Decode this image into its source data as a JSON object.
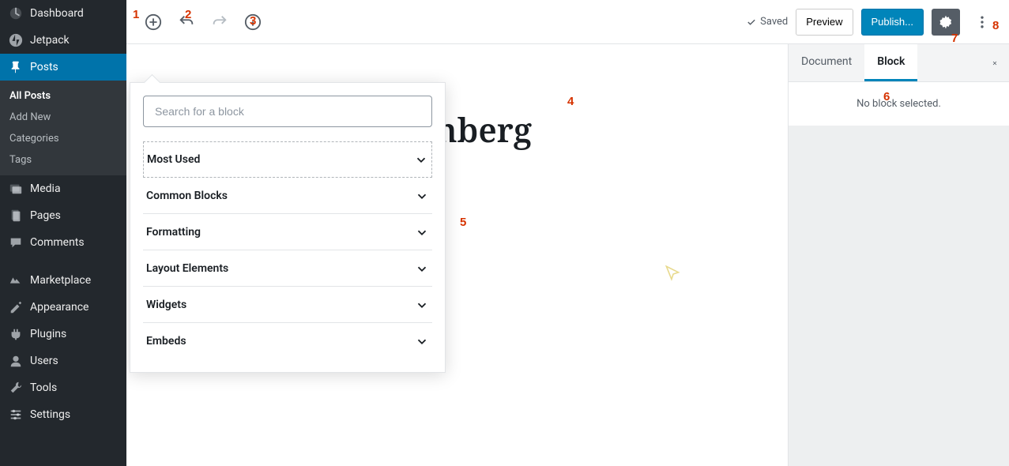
{
  "annotations": [
    "1",
    "2",
    "3",
    "4",
    "5",
    "6",
    "7",
    "8"
  ],
  "sidebar": {
    "items": [
      {
        "label": "Dashboard"
      },
      {
        "label": "Jetpack"
      },
      {
        "label": "Posts"
      },
      {
        "label": "Media"
      },
      {
        "label": "Pages"
      },
      {
        "label": "Comments"
      },
      {
        "label": "Marketplace"
      },
      {
        "label": "Appearance"
      },
      {
        "label": "Plugins"
      },
      {
        "label": "Users"
      },
      {
        "label": "Tools"
      },
      {
        "label": "Settings"
      }
    ],
    "posts_sub": [
      {
        "label": "All Posts"
      },
      {
        "label": "Add New"
      },
      {
        "label": "Categories"
      },
      {
        "label": "Tags"
      }
    ]
  },
  "topbar": {
    "saved_label": "Saved",
    "preview_label": "Preview",
    "publish_label": "Publish..."
  },
  "inserter": {
    "search_placeholder": "Search for a block",
    "categories": [
      {
        "label": "Most Used"
      },
      {
        "label": "Common Blocks"
      },
      {
        "label": "Formatting"
      },
      {
        "label": "Layout Elements"
      },
      {
        "label": "Widgets"
      },
      {
        "label": "Embeds"
      }
    ]
  },
  "editor": {
    "title_visible": "utenberg"
  },
  "settings": {
    "tab_document": "Document",
    "tab_block": "Block",
    "no_block_msg": "No block selected."
  }
}
